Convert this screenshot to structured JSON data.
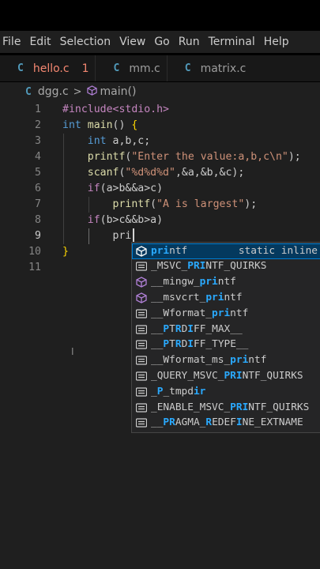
{
  "menubar": [
    "File",
    "Edit",
    "Selection",
    "View",
    "Go",
    "Run",
    "Terminal",
    "Help"
  ],
  "tabs": [
    {
      "icon": "C",
      "label": "hello.c",
      "badge": "1"
    },
    {
      "icon": "C",
      "label": "mm.c"
    },
    {
      "icon": "C",
      "label": "matrix.c"
    }
  ],
  "breadcrumb": {
    "icon": "C",
    "file": "dgg.c",
    "separator": ">",
    "symbol": "main()"
  },
  "editor": {
    "line_numbers": [
      "1",
      "2",
      "3",
      "4",
      "5",
      "6",
      "7",
      "8",
      "9",
      "10",
      "11"
    ],
    "lines": [
      [
        [
          "pp",
          "#include<stdio.h>"
        ]
      ],
      [
        [
          "kw",
          "int "
        ],
        [
          "fn",
          "main"
        ],
        [
          "txt",
          "() "
        ],
        [
          "br",
          "{"
        ]
      ],
      [
        [
          "kw",
          "    int "
        ],
        [
          "txt",
          "a,b,c;"
        ]
      ],
      [
        [
          "fn",
          "    printf"
        ],
        [
          "txt",
          "("
        ],
        [
          "str",
          "\"Enter the value:a,b,c\\n\""
        ],
        [
          "txt",
          ");"
        ]
      ],
      [
        [
          "fn",
          "    scanf"
        ],
        [
          "txt",
          "("
        ],
        [
          "str",
          "\"%d%d%d\""
        ],
        [
          "txt",
          ",&a,&b,&c);"
        ]
      ],
      [
        [
          "pp",
          "    if"
        ],
        [
          "txt",
          "(a>b&&a>c)"
        ]
      ],
      [
        [
          "fn",
          "        printf"
        ],
        [
          "txt",
          "("
        ],
        [
          "str",
          "\"A is largest\""
        ],
        [
          "txt",
          ");"
        ]
      ],
      [
        [
          "pp",
          "    if"
        ],
        [
          "txt",
          "(b>c&&b>a)"
        ]
      ],
      [
        [
          "txt",
          "        pri"
        ]
      ],
      [
        [
          "br",
          "}"
        ]
      ],
      [
        [
          "txt",
          ""
        ]
      ]
    ]
  },
  "suggestions": [
    {
      "icon": "cube",
      "parts": [
        [
          "hl",
          "pri"
        ],
        [
          "",
          "ntf"
        ]
      ],
      "detail": "static inline",
      "selected": true
    },
    {
      "icon": "text",
      "parts": [
        [
          "",
          "_MSVC_"
        ],
        [
          "hl",
          "PRI"
        ],
        [
          "",
          "NTF_QUIRKS"
        ]
      ]
    },
    {
      "icon": "cube",
      "parts": [
        [
          "",
          "__mingw_"
        ],
        [
          "hl",
          "pri"
        ],
        [
          "",
          "ntf"
        ]
      ]
    },
    {
      "icon": "cube",
      "parts": [
        [
          "",
          "__msvcrt_"
        ],
        [
          "hl",
          "pri"
        ],
        [
          "",
          "ntf"
        ]
      ]
    },
    {
      "icon": "text",
      "parts": [
        [
          "",
          "__Wformat_"
        ],
        [
          "hl",
          "pri"
        ],
        [
          "",
          "ntf"
        ]
      ]
    },
    {
      "icon": "text",
      "parts": [
        [
          "",
          "__"
        ],
        [
          "hl",
          "P"
        ],
        [
          "",
          "T"
        ],
        [
          "hl",
          "R"
        ],
        [
          "",
          "D"
        ],
        [
          "hl",
          "I"
        ],
        [
          "",
          "FF_MAX__"
        ]
      ]
    },
    {
      "icon": "text",
      "parts": [
        [
          "",
          "__"
        ],
        [
          "hl",
          "P"
        ],
        [
          "",
          "T"
        ],
        [
          "hl",
          "R"
        ],
        [
          "",
          "D"
        ],
        [
          "hl",
          "I"
        ],
        [
          "",
          "FF_TYPE__"
        ]
      ]
    },
    {
      "icon": "text",
      "parts": [
        [
          "",
          "__Wformat_ms_"
        ],
        [
          "hl",
          "pri"
        ],
        [
          "",
          "ntf"
        ]
      ]
    },
    {
      "icon": "text",
      "parts": [
        [
          "",
          "_QUERY_MSVC_"
        ],
        [
          "hl",
          "PRI"
        ],
        [
          "",
          "NTF_QUIRKS"
        ]
      ]
    },
    {
      "icon": "text",
      "parts": [
        [
          "",
          "_"
        ],
        [
          "hl",
          "P"
        ],
        [
          "",
          "_tmpd"
        ],
        [
          "hl",
          "ir"
        ]
      ]
    },
    {
      "icon": "text",
      "parts": [
        [
          "",
          "_ENABLE_MSVC_"
        ],
        [
          "hl",
          "PRI"
        ],
        [
          "",
          "NTF_QUIRKS"
        ]
      ]
    },
    {
      "icon": "text",
      "parts": [
        [
          "",
          "__"
        ],
        [
          "hl",
          "PR"
        ],
        [
          "",
          "AGMA_"
        ],
        [
          "hl",
          "R"
        ],
        [
          "",
          "EDEF"
        ],
        [
          "hl",
          "I"
        ],
        [
          "",
          "NE_EXTNAME"
        ]
      ]
    }
  ],
  "colors": {
    "editor_bg": "#1f1f1f",
    "accent": "#2aaaff",
    "keyword": "#569cd6",
    "function": "#dcdcaa",
    "string": "#ce9178",
    "preproc": "#c586c0"
  }
}
